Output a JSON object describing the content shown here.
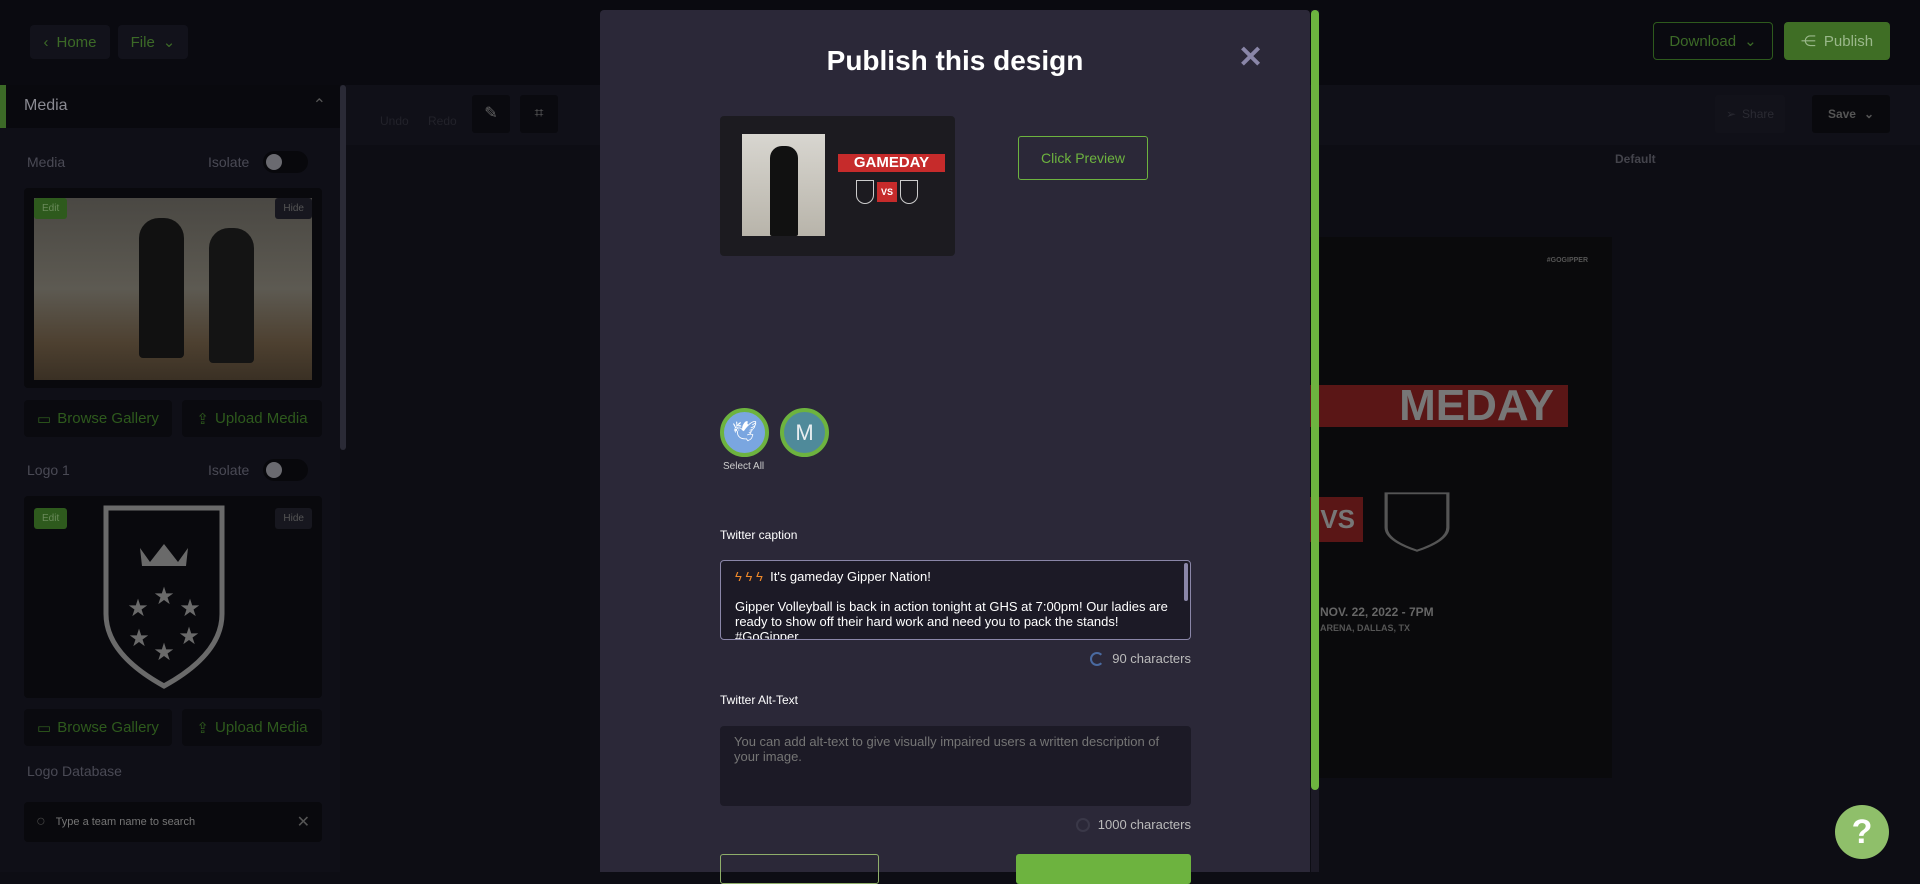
{
  "topbar": {
    "home": "Home",
    "file": "File",
    "download": "Download",
    "publish": "Publish"
  },
  "toolbar": {
    "undo": "Undo",
    "redo": "Redo",
    "share": "Share",
    "save": "Save",
    "canvas_label": "Default"
  },
  "sidebar": {
    "section_title": "Media",
    "media": {
      "label": "Media",
      "isolate": "Isolate",
      "edit": "Edit",
      "hide": "Hide",
      "browse": "Browse Gallery",
      "upload": "Upload Media"
    },
    "logo1": {
      "label": "Logo 1",
      "isolate": "Isolate",
      "edit": "Edit",
      "hide": "Hide",
      "browse": "Browse Gallery",
      "upload": "Upload Media"
    },
    "logo_db": {
      "label": "Logo Database",
      "placeholder": "Type a team name to search"
    }
  },
  "canvas": {
    "hashtag": "#GOGIPPER",
    "headline": "MEDAY",
    "vs": "VS",
    "date": "NOV. 22, 2022 - 7PM",
    "venue": "ARENA, DALLAS, TX"
  },
  "modal": {
    "title": "Publish this design",
    "thumbnail": {
      "headline": "GAMEDAY",
      "vs": "VS"
    },
    "preview_button": "Click Preview",
    "accounts": [
      {
        "icon": "twitter-icon",
        "color": "#7aa6e0"
      },
      {
        "letter": "M",
        "color": "#4f8a9a"
      }
    ],
    "select_all": "Select All",
    "caption_label": "Twitter caption",
    "caption_line1": "It's gameday Gipper Nation!",
    "caption_body": "Gipper Volleyball is back in action tonight at GHS at 7:00pm! Our ladies are ready to show off their hard work and need you to pack the stands! #GoGipper",
    "caption_count": "90 characters",
    "alt_label": "Twitter Alt-Text",
    "alt_placeholder": "You can add alt-text to give visually impaired users a written description of your image.",
    "alt_count": "1000 characters"
  },
  "colors": {
    "accent": "#6db33f",
    "modal_bg": "#2b2838"
  }
}
